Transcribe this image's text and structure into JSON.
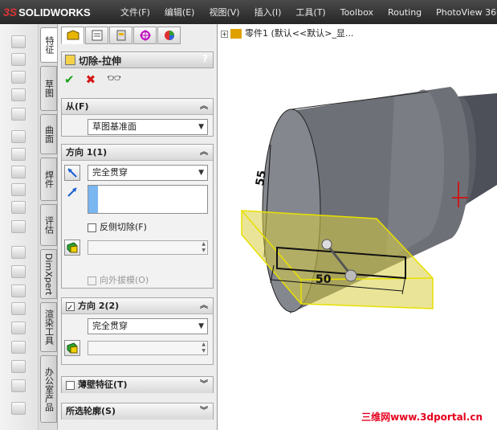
{
  "app": {
    "logo_text": "SOLIDWORKS",
    "logo_mark": "3S"
  },
  "menubar": {
    "items": [
      "文件(F)",
      "编辑(E)",
      "视图(V)",
      "插入(I)",
      "工具(T)",
      "Toolbox",
      "Routing",
      "PhotoView 360"
    ]
  },
  "vertical_tabs": [
    "特征",
    "草图",
    "曲面",
    "焊件",
    "评估",
    "DimXpert",
    "渲染工具",
    "办公室产品"
  ],
  "feature": {
    "title": "切除-拉伸",
    "help": "?"
  },
  "from_group": {
    "title": "从(F)",
    "value": "草图基准面"
  },
  "direction1": {
    "title": "方向 1(1)",
    "end_condition": "完全贯穿",
    "flip_side_label": "反侧切除(F)",
    "draft_outward_label": "向外拔模(O)"
  },
  "direction2": {
    "title": "方向 2(2)",
    "end_condition": "完全贯穿"
  },
  "thin_feature": {
    "title": "薄壁特征(T)"
  },
  "selected_contours": {
    "title": "所选轮廓(S)"
  },
  "tree": {
    "item": "零件1 (默认<<默认>_显..."
  },
  "model": {
    "dim_diameter": "55",
    "dim_width": "50"
  },
  "watermark": "三维网www.3dportal.cn",
  "colors": {
    "menubar": "#333333",
    "sketch_yellow": "#f2e600",
    "body_gray": "#6e7077",
    "watermark_red": "#e5001e"
  }
}
